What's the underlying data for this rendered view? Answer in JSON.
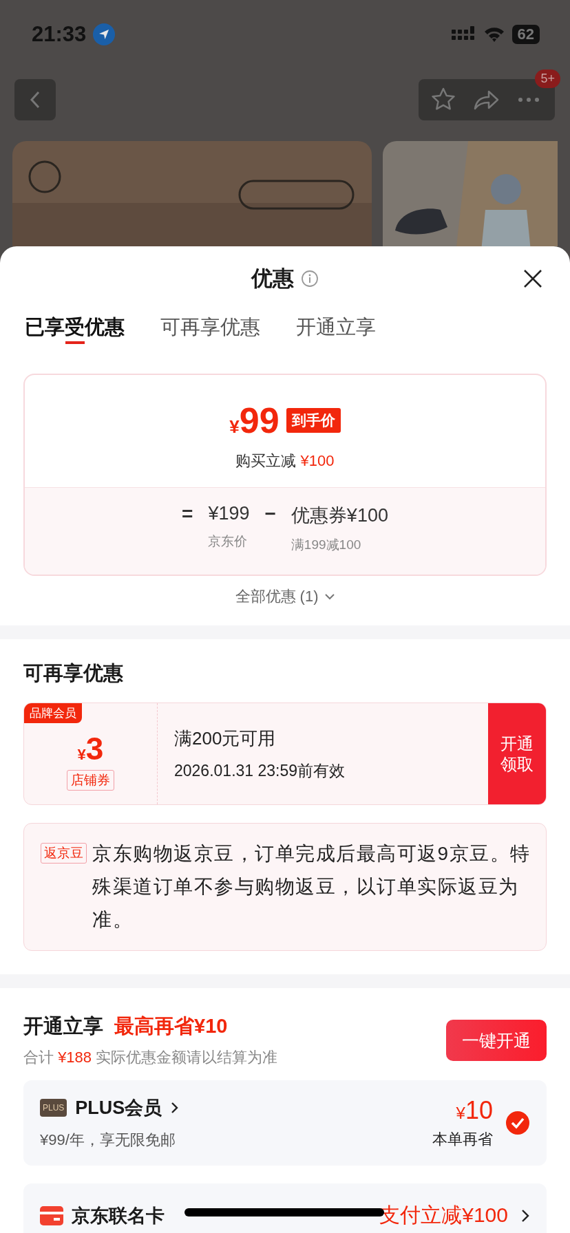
{
  "status_bar": {
    "time": "21:33",
    "battery": "62"
  },
  "nav": {
    "badge": "5+"
  },
  "sheet": {
    "title": "优惠",
    "tabs": [
      {
        "label": "已享受优惠",
        "selected": true
      },
      {
        "label": "可再享优惠",
        "selected": false
      },
      {
        "label": "开通立享",
        "selected": false
      }
    ],
    "final_price": {
      "currency": "¥",
      "price": "99",
      "tag": "到手价",
      "subtitle": "购买立减",
      "subtitle_amount": "¥100"
    },
    "breakdown": {
      "equals": "=",
      "base": "¥199",
      "minus": "−",
      "coupon": "优惠券¥100",
      "base_label": "京东价",
      "coupon_label": "满199减100"
    },
    "all_discounts": "全部优惠 (1)"
  },
  "extra": {
    "heading": "可再享优惠",
    "coupon": {
      "badge": "品牌会员",
      "currency": "¥",
      "amount": "3",
      "type": "店铺券",
      "condition": "满200元可用",
      "validity": "2026.01.31 23:59前有效",
      "action": "开通领取"
    },
    "beans": {
      "tag": "返京豆",
      "text": "京东购物返京豆，订单完成后最高可返9京豆。特殊渠道订单不参与购物返豆，以订单实际返豆为准。"
    }
  },
  "membership": {
    "heading": "开通立享",
    "highlight": "最高再省¥10",
    "total_label": "合计",
    "total": "¥188",
    "note": "实际优惠金额请以结算为准",
    "button": "一键开通",
    "items": [
      {
        "kind": "plus",
        "logo": "PLUS",
        "name": "PLUS会员",
        "desc": "¥99/年，享无限免邮",
        "currency": "¥",
        "amount": "10",
        "amount_label": "本单再省",
        "checked": true
      },
      {
        "kind": "card",
        "name": "京东联名卡",
        "offer": "支付立减¥100"
      }
    ]
  }
}
